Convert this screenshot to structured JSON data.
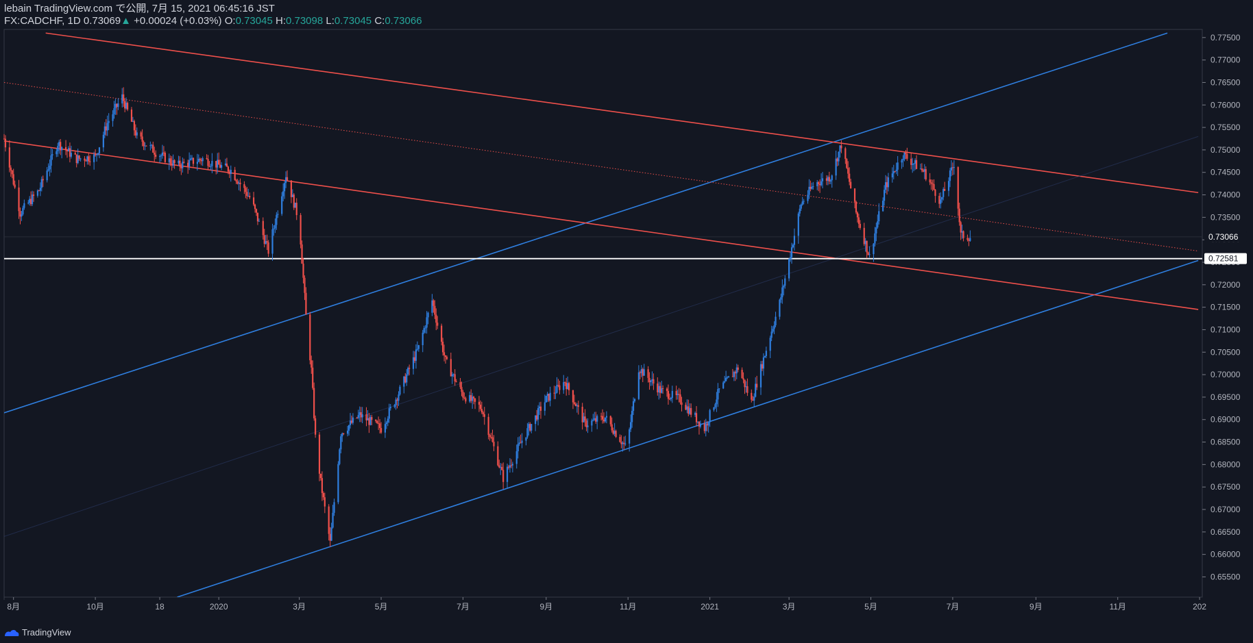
{
  "header": {
    "line1": "lebain TradingView.com で公開, 7月 15, 2021 06:45:16 JST",
    "symbol": "FX:CADCHF, 1D",
    "last": "0.73069",
    "change_arrow": "▲",
    "change": "+0.00024 (+0.03%)",
    "o_label": "O:",
    "o": "0.73045",
    "h_label": "H:",
    "h": "0.73098",
    "l_label": "L:",
    "l": "0.73045",
    "c_label": "C:",
    "c": "0.73066"
  },
  "footer": {
    "brand": "TradingView",
    "logo_icon": "tradingview-logo-icon"
  },
  "colors": {
    "background": "#131722",
    "up": "#2f7fe0",
    "down": "#f0504b",
    "blue_line": "#2f7fe0",
    "red_line": "#f0504b",
    "axis_text": "#b2b5be"
  },
  "chart_data": {
    "type": "candlestick",
    "symbol": "FX:CADCHF",
    "timeframe": "1D",
    "ylim": [
      0.6505,
      0.7768
    ],
    "y_ticks": [
      "0.77500",
      "0.77000",
      "0.76500",
      "0.76000",
      "0.75500",
      "0.75000",
      "0.74500",
      "0.74000",
      "0.73500",
      "0.73000",
      "0.72500",
      "0.72000",
      "0.71500",
      "0.71000",
      "0.70500",
      "0.70000",
      "0.69500",
      "0.69000",
      "0.68500",
      "0.68000",
      "0.67500",
      "0.67000",
      "0.66500",
      "0.66000",
      "0.65500"
    ],
    "x_range": [
      "2019-07-25",
      "2022-01-03"
    ],
    "x_ticks": [
      {
        "date": "2019-08-01",
        "label": "8月"
      },
      {
        "date": "2019-10-01",
        "label": "10月"
      },
      {
        "date": "2019-11-18",
        "label": "18"
      },
      {
        "date": "2020-01-01",
        "label": "2020"
      },
      {
        "date": "2020-03-01",
        "label": "3月"
      },
      {
        "date": "2020-05-01",
        "label": "5月"
      },
      {
        "date": "2020-07-01",
        "label": "7月"
      },
      {
        "date": "2020-09-01",
        "label": "9月"
      },
      {
        "date": "2020-11-01",
        "label": "11月"
      },
      {
        "date": "2021-01-01",
        "label": "2021"
      },
      {
        "date": "2021-03-01",
        "label": "3月"
      },
      {
        "date": "2021-05-01",
        "label": "5月"
      },
      {
        "date": "2021-07-01",
        "label": "7月"
      },
      {
        "date": "2021-09-01",
        "label": "9月"
      },
      {
        "date": "2021-11-01",
        "label": "11月"
      },
      {
        "date": "2022-01-01",
        "label": "202"
      }
    ],
    "price_path": [
      [
        "2019-07-25",
        0.7525
      ],
      [
        "2019-08-06",
        0.736
      ],
      [
        "2019-08-20",
        0.741
      ],
      [
        "2019-09-03",
        0.7515
      ],
      [
        "2019-09-17",
        0.748
      ],
      [
        "2019-10-01",
        0.7485
      ],
      [
        "2019-10-10",
        0.756
      ],
      [
        "2019-10-21",
        0.7618
      ],
      [
        "2019-11-01",
        0.753
      ],
      [
        "2019-11-15",
        0.7495
      ],
      [
        "2019-12-01",
        0.7465
      ],
      [
        "2019-12-20",
        0.748
      ],
      [
        "2020-01-10",
        0.7455
      ],
      [
        "2020-01-25",
        0.739
      ],
      [
        "2020-02-07",
        0.7275
      ],
      [
        "2020-02-20",
        0.7445
      ],
      [
        "2020-03-01",
        0.734
      ],
      [
        "2020-03-06",
        0.713
      ],
      [
        "2020-03-10",
        0.701
      ],
      [
        "2020-03-13",
        0.686
      ],
      [
        "2020-03-17",
        0.676
      ],
      [
        "2020-03-24",
        0.6625
      ],
      [
        "2020-04-01",
        0.687
      ],
      [
        "2020-04-15",
        0.691
      ],
      [
        "2020-05-01",
        0.688
      ],
      [
        "2020-05-15",
        0.6965
      ],
      [
        "2020-05-29",
        0.706
      ],
      [
        "2020-06-08",
        0.7165
      ],
      [
        "2020-06-18",
        0.703
      ],
      [
        "2020-07-01",
        0.6955
      ],
      [
        "2020-07-15",
        0.6925
      ],
      [
        "2020-07-31",
        0.677
      ],
      [
        "2020-08-15",
        0.686
      ],
      [
        "2020-09-01",
        0.6945
      ],
      [
        "2020-09-15",
        0.6985
      ],
      [
        "2020-09-30",
        0.689
      ],
      [
        "2020-10-15",
        0.6905
      ],
      [
        "2020-10-31",
        0.6835
      ],
      [
        "2020-11-09",
        0.7015
      ],
      [
        "2020-11-25",
        0.6965
      ],
      [
        "2020-12-10",
        0.6945
      ],
      [
        "2020-12-28",
        0.688
      ],
      [
        "2021-01-08",
        0.6965
      ],
      [
        "2021-01-22",
        0.7015
      ],
      [
        "2021-02-01",
        0.694
      ],
      [
        "2021-02-10",
        0.7035
      ],
      [
        "2021-02-22",
        0.716
      ],
      [
        "2021-03-01",
        0.7255
      ],
      [
        "2021-03-10",
        0.738
      ],
      [
        "2021-03-20",
        0.7425
      ],
      [
        "2021-04-01",
        0.744
      ],
      [
        "2021-04-09",
        0.7512
      ],
      [
        "2021-04-20",
        0.736
      ],
      [
        "2021-04-30",
        0.7262
      ],
      [
        "2021-05-12",
        0.742
      ],
      [
        "2021-05-25",
        0.749
      ],
      [
        "2021-06-10",
        0.745
      ],
      [
        "2021-06-22",
        0.7385
      ],
      [
        "2021-07-02",
        0.747
      ],
      [
        "2021-07-07",
        0.731
      ],
      [
        "2021-07-14",
        0.73066
      ]
    ],
    "horizontal_line": 0.72581,
    "last_price": 0.73066,
    "price_labels": [
      "0.73066",
      "0.72581"
    ],
    "trendlines": [
      {
        "color": "blue",
        "style": "solid",
        "p1": [
          "2019-07-25",
          0.6915
        ],
        "p2": [
          "2021-12-08",
          0.776
        ]
      },
      {
        "color": "blue",
        "style": "solid",
        "p1": [
          "2019-12-01",
          0.6505
        ],
        "p2": [
          "2021-12-31",
          0.7254
        ]
      },
      {
        "color": "red",
        "style": "solid",
        "p1": [
          "2019-08-25",
          0.776
        ],
        "p2": [
          "2021-12-31",
          0.7405
        ]
      },
      {
        "color": "red",
        "style": "solid",
        "p1": [
          "2019-07-25",
          0.752
        ],
        "p2": [
          "2021-12-31",
          0.7145
        ]
      },
      {
        "color": "red",
        "style": "dotted",
        "p1": [
          "2019-07-25",
          0.765
        ],
        "p2": [
          "2021-12-31",
          0.7275
        ]
      },
      {
        "color": "navy",
        "style": "faint",
        "p1": [
          "2019-07-25",
          0.664
        ],
        "p2": [
          "2021-12-31",
          0.753
        ]
      }
    ]
  }
}
